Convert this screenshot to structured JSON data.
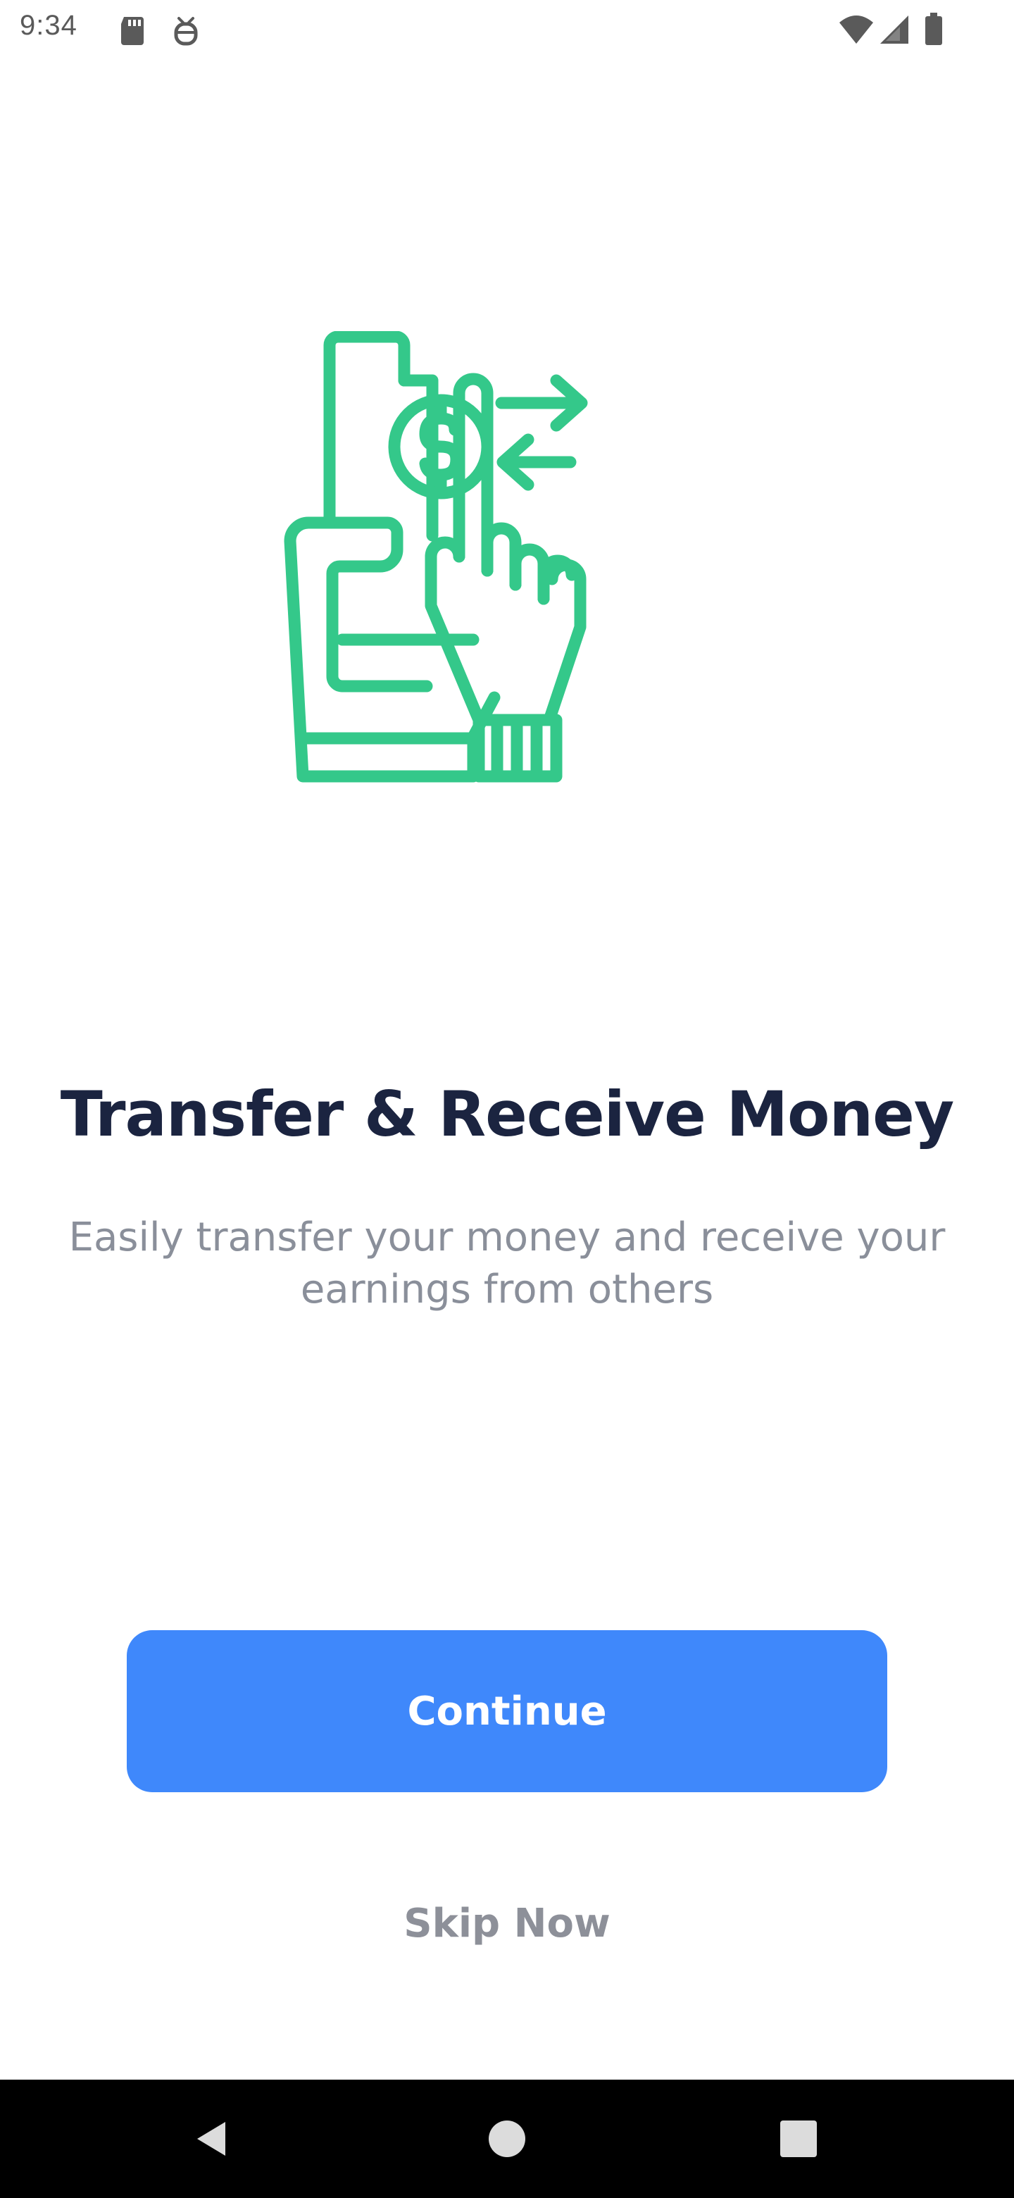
{
  "status_bar": {
    "time": "9:34",
    "icons": [
      "sd-card-icon",
      "debug-icon",
      "wifi-icon",
      "signal-icon",
      "battery-icon"
    ]
  },
  "illustration": {
    "icon": "money-transfer-icon",
    "color": "#34c88a"
  },
  "onboarding": {
    "title": "Transfer & Receive Money",
    "subtitle_line1": "Easily transfer your money and receive your",
    "subtitle_line2": "earnings from others"
  },
  "actions": {
    "continue_label": "Continue",
    "skip_label": "Skip Now"
  },
  "colors": {
    "primary": "#3f88fb",
    "title": "#1b2440",
    "subtitle": "#8a8f9a",
    "accent_green": "#34c88a"
  },
  "nav_bar": {
    "icons": [
      "back-icon",
      "home-icon",
      "recents-icon"
    ]
  }
}
